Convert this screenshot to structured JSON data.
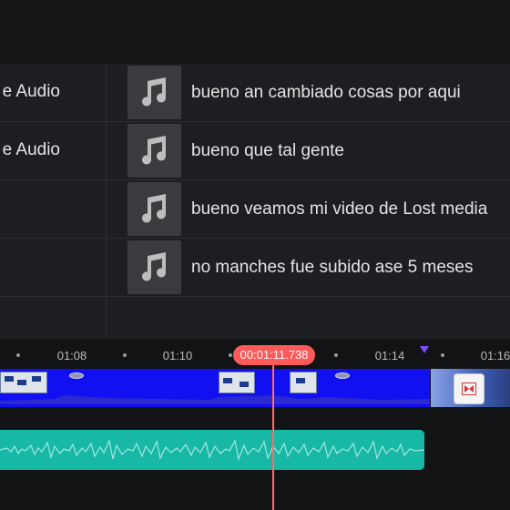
{
  "top_bar": {},
  "audio_list": {
    "left_items": [
      {
        "label": "e Audio"
      },
      {
        "label": "e Audio"
      },
      {
        "label": ""
      },
      {
        "label": ""
      }
    ],
    "items": [
      {
        "icon": "music-note-icon",
        "title": "bueno an cambiado cosas por aqui"
      },
      {
        "icon": "music-note-icon",
        "title": "bueno que tal gente"
      },
      {
        "icon": "music-note-icon",
        "title": "bueno veamos mi video de Lost media"
      },
      {
        "icon": "music-note-icon",
        "title": "no manches fue subido ase 5 meses"
      }
    ]
  },
  "timeline": {
    "ticks": [
      "01:08",
      "01:10",
      "01:14",
      "01:16"
    ],
    "playhead": "00:01:11.738",
    "colors": {
      "video_track": "#1010f0",
      "audio_track": "#17b8a6",
      "playhead": "#ff5a5a",
      "marker": "#7b4ef5"
    },
    "transition_icon": "transition-icon",
    "marker_icon": "marker-triangle-icon"
  }
}
